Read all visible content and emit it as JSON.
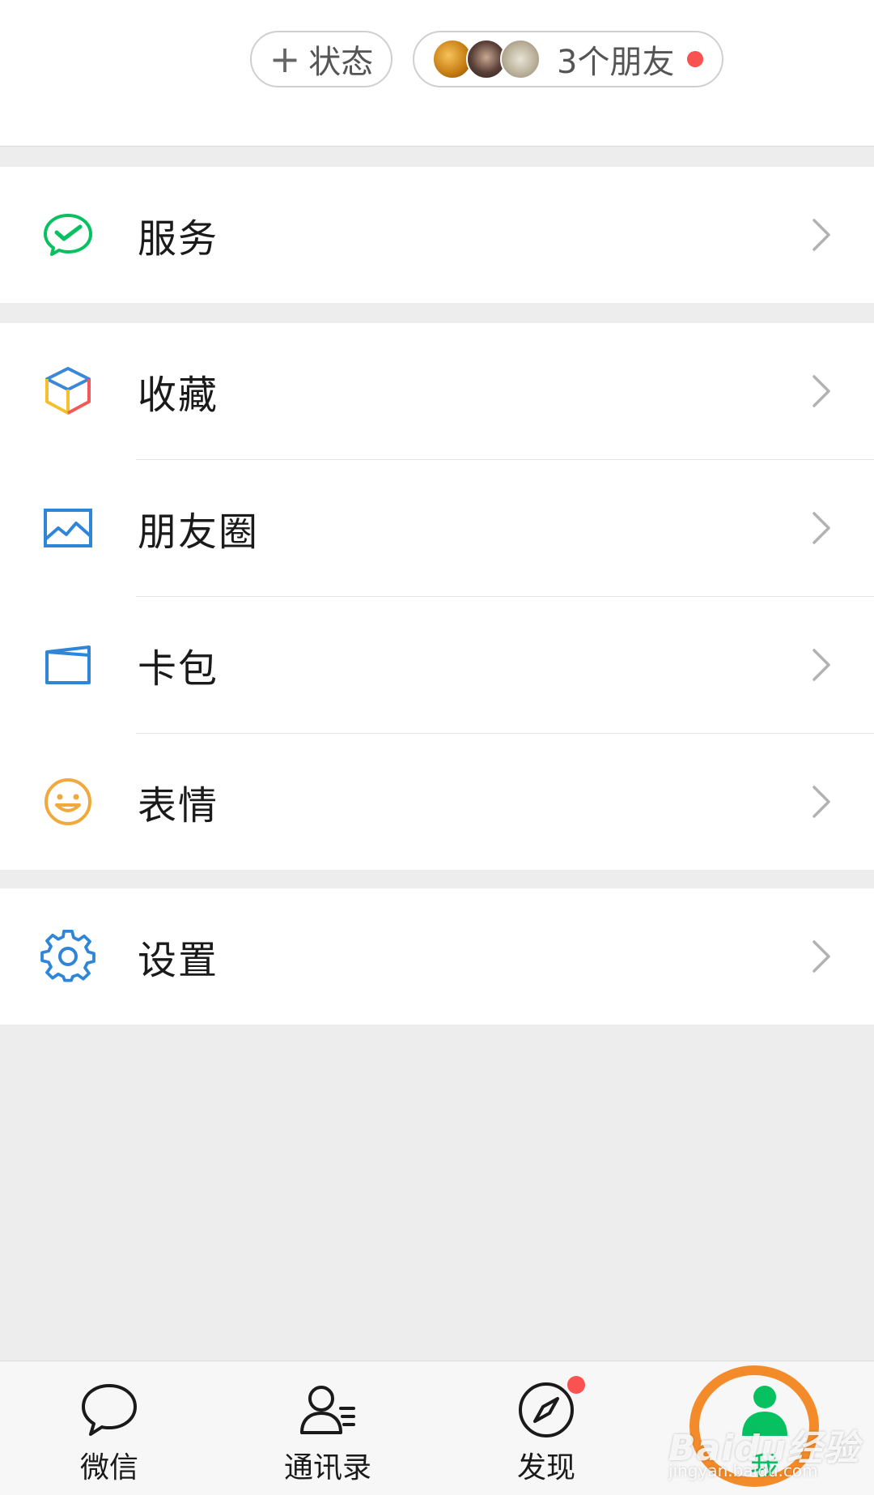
{
  "header": {
    "status_button": {
      "plus": "+",
      "label": "状态"
    },
    "friends_button": {
      "label": "3个朋友"
    }
  },
  "menu": {
    "services": {
      "label": "服务",
      "icon": "wechat-pay-icon"
    },
    "favorites": {
      "label": "收藏",
      "icon": "cube-icon"
    },
    "moments": {
      "label": "朋友圈",
      "icon": "picture-icon"
    },
    "card_pack": {
      "label": "卡包",
      "icon": "card-icon"
    },
    "stickers": {
      "label": "表情",
      "icon": "smiley-icon"
    },
    "settings": {
      "label": "设置",
      "icon": "gear-icon"
    }
  },
  "tabbar": {
    "tabs": [
      {
        "label": "微信",
        "icon": "chat-bubble-icon"
      },
      {
        "label": "通讯录",
        "icon": "contacts-icon"
      },
      {
        "label": "发现",
        "icon": "compass-icon"
      },
      {
        "label": "我",
        "icon": "person-icon"
      }
    ]
  },
  "watermark": {
    "logo": "Baidu经验",
    "url": "jingyan.baidu.com"
  },
  "colors": {
    "accent": "#07c160",
    "badge": "#fa5151",
    "highlight": "#f38b2a",
    "background": "#ededed"
  }
}
